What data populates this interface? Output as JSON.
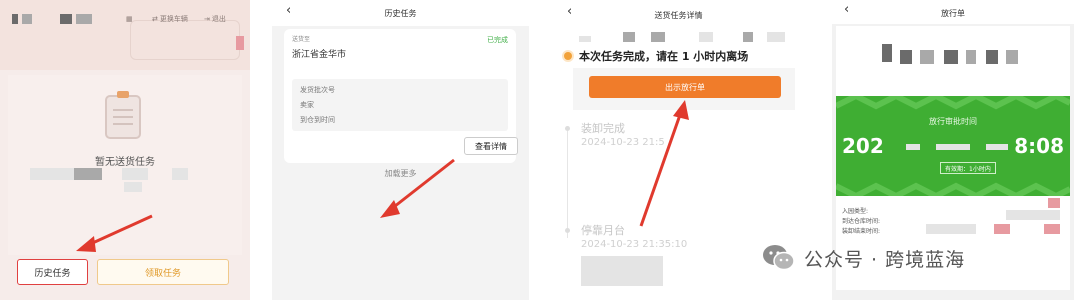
{
  "panel1": {
    "header_buttons": {
      "switch_vehicle": "更换车辆",
      "logout": "退出"
    },
    "empty_text": "暂无送货任务",
    "buttons": {
      "history": "历史任务",
      "claim": "领取任务"
    }
  },
  "panel2": {
    "title": "历史任务",
    "card": {
      "label_top": "送货至",
      "status": "已完成",
      "city": "浙江省金华市",
      "rows": [
        "发货批次号",
        "卖家",
        "到仓到时间"
      ],
      "detail_button": "查看详情"
    },
    "load_more": "加载更多"
  },
  "panel3": {
    "title": "送货任务详情",
    "notice": "本次任务完成，请在 1 小时内离场",
    "pass_button": "出示放行单",
    "timeline": [
      {
        "title": "装卸完成",
        "time": "2024-10-23 21:5"
      },
      {
        "title": "停靠月台",
        "time": "2024-10-23 21:35:10"
      }
    ]
  },
  "panel4": {
    "title": "放行单",
    "green": {
      "label": "放行审批时间",
      "time_left": "202",
      "time_right": "8:08",
      "validity": "有效期：1小时内"
    },
    "info_rows": [
      "入园类型:",
      "到达仓库时间:",
      "装卸结束时间:"
    ]
  },
  "watermark": "公众号 · 跨境蓝海",
  "colors": {
    "accent_orange": "#f07c2a",
    "success_green": "#43b04a",
    "pass_green": "#3fae33",
    "arrow_red": "#e03a2e"
  }
}
